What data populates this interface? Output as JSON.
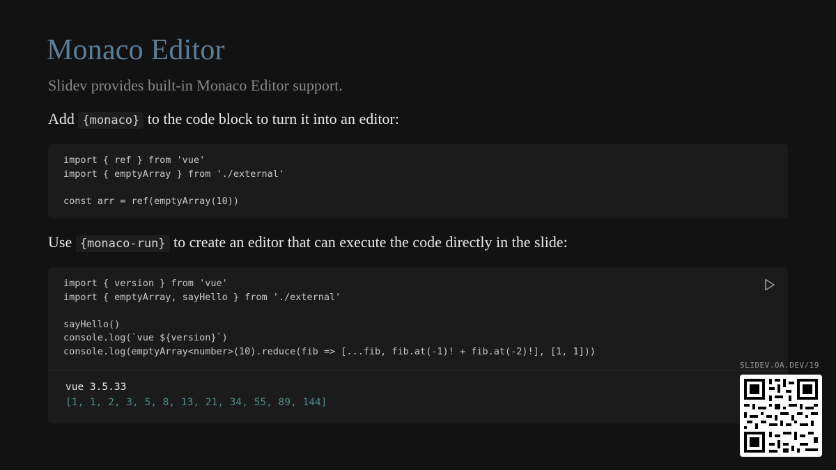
{
  "slide": {
    "title": "Monaco Editor",
    "subtitle": "Slidev provides built-in Monaco Editor support.",
    "para1": {
      "before": "Add",
      "code": "{monaco}",
      "after": "to the code block to turn it into an editor:"
    },
    "para2": {
      "before": "Use",
      "code": "{monaco-run}",
      "after": "to create an editor that can execute the code directly in the slide:"
    }
  },
  "editor1": {
    "lines": [
      "import { ref } from 'vue'",
      "import { emptyArray } from './external'",
      "",
      "const arr = ref(emptyArray(10))"
    ]
  },
  "editor2": {
    "lines": [
      "import { version } from 'vue'",
      "import { emptyArray, sayHello } from './external'",
      "",
      "sayHello()",
      "console.log(`vue ${version}`)",
      "console.log(emptyArray<number>(10).reduce(fib => [...fib, fib.at(-1)! + fib.at(-2)!], [1, 1]))"
    ],
    "run_icon": "play-icon",
    "output": [
      "vue 3.5.33",
      "[1, 1, 2, 3, 5, 8, 13, 21, 34, 55, 89, 144]"
    ]
  },
  "footer": {
    "url": "SLIDEV.OA.DEV/19",
    "qr_icon": "qr-code-icon"
  },
  "colors": {
    "background": "#121212",
    "title": "#5b7f99",
    "bracket": "#5b8ba6",
    "output_array": "#4f8c8c"
  }
}
